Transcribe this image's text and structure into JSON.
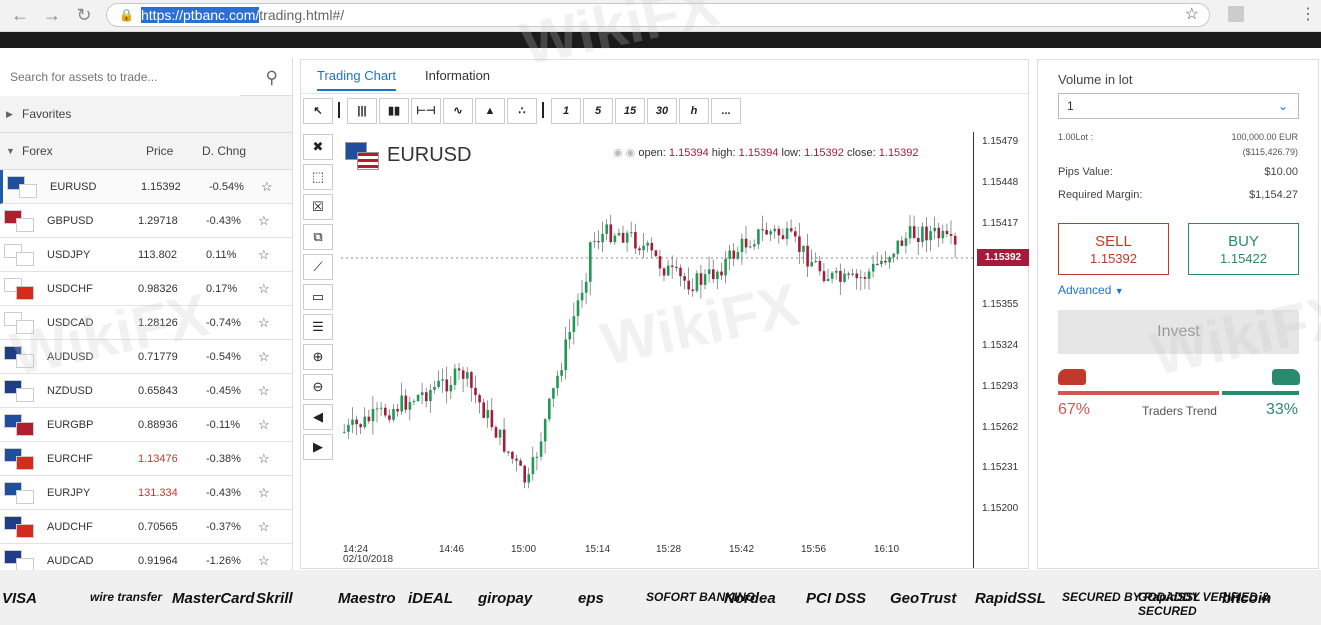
{
  "browser": {
    "url_selected": "https://ptbanc.com/",
    "url_rest": "trading.html#/"
  },
  "search": {
    "placeholder": "Search for assets to trade..."
  },
  "groups": {
    "favorites": "Favorites",
    "forex": "Forex",
    "col_price": "Price",
    "col_change": "D. Chng"
  },
  "assets": [
    {
      "symbol": "EURUSD",
      "price": "1.15392",
      "change": "-0.54%",
      "c1": "#1f4e9c",
      "c2": "#ffffff",
      "active": true
    },
    {
      "symbol": "GBPUSD",
      "price": "1.29718",
      "change": "-0.43%",
      "c1": "#b01e2f",
      "c2": "#ffffff"
    },
    {
      "symbol": "USDJPY",
      "price": "113.802",
      "change": "0.11%",
      "c1": "#ffffff",
      "c2": "#ffffff"
    },
    {
      "symbol": "USDCHF",
      "price": "0.98326",
      "change": "0.17%",
      "c1": "#ffffff",
      "c2": "#d52b1e"
    },
    {
      "symbol": "USDCAD",
      "price": "1.28126",
      "change": "-0.74%",
      "c1": "#ffffff",
      "c2": "#ffffff"
    },
    {
      "symbol": "AUDUSD",
      "price": "0.71779",
      "change": "-0.54%",
      "c1": "#1f3c88",
      "c2": "#ffffff"
    },
    {
      "symbol": "NZDUSD",
      "price": "0.65843",
      "change": "-0.45%",
      "c1": "#1f3c88",
      "c2": "#ffffff"
    },
    {
      "symbol": "EURGBP",
      "price": "0.88936",
      "change": "-0.11%",
      "c1": "#1f4e9c",
      "c2": "#b01e2f"
    },
    {
      "symbol": "EURCHF",
      "price": "1.13476",
      "change": "-0.38%",
      "c1": "#1f4e9c",
      "c2": "#d52b1e",
      "red": true
    },
    {
      "symbol": "EURJPY",
      "price": "131.334",
      "change": "-0.43%",
      "c1": "#1f4e9c",
      "c2": "#ffffff",
      "red": true
    },
    {
      "symbol": "AUDCHF",
      "price": "0.70565",
      "change": "-0.37%",
      "c1": "#1f3c88",
      "c2": "#d52b1e"
    },
    {
      "symbol": "AUDCAD",
      "price": "0.91964",
      "change": "-1.26%",
      "c1": "#1f3c88",
      "c2": "#ffffff"
    }
  ],
  "tabs": {
    "chart": "Trading Chart",
    "info": "Information"
  },
  "toolbar": {
    "periods": [
      "1",
      "5",
      "15",
      "30",
      "h",
      "..."
    ],
    "chart_types": [
      "bars-icon",
      "candles-icon",
      "ohlc-icon",
      "line-icon",
      "area-icon",
      "dots-icon"
    ]
  },
  "chart": {
    "symbol": "EURUSD",
    "open_label": "open:",
    "open": "1.15394",
    "high_label": "high:",
    "high": "1.15394",
    "low_label": "low:",
    "low": "1.15392",
    "close_label": "close:",
    "close": "1.15392",
    "current_price": "1.15392",
    "price_ticks": [
      "1.15479",
      "1.15448",
      "1.15417",
      "1.15386",
      "1.15355",
      "1.15324",
      "1.15293",
      "1.15262",
      "1.15231",
      "1.15200"
    ],
    "time_ticks": [
      "14:24",
      "14:46",
      "15:00",
      "15:14",
      "15:28",
      "15:42",
      "15:56",
      "16:10"
    ],
    "date_label": "02/10/2018"
  },
  "trade": {
    "volume_label": "Volume in lot",
    "volume_value": "1",
    "lot_label": "1.00Lot :",
    "lot_value": "100,000.00 EUR",
    "lot_value_usd": "($115,426.79)",
    "pips_label": "Pips Value:",
    "pips_value": "$10.00",
    "margin_label": "Required Margin:",
    "margin_value": "$1,154.27",
    "sell_label": "SELL",
    "sell_price": "1.15392",
    "buy_label": "BUY",
    "buy_price": "1.15422",
    "advanced": "Advanced",
    "invest": "Invest",
    "sell_pct": "67%",
    "buy_pct": "33%",
    "sell_fraction": 0.67,
    "trend_label": "Traders Trend"
  },
  "payments": [
    "VISA",
    "wire transfer",
    "MasterCard",
    "Skrill",
    "Maestro",
    "iDEAL",
    "giropay",
    "eps",
    "SOFORT BANKING",
    "Nordea",
    "PCI DSS",
    "GeoTrust",
    "RapidSSL",
    "SECURED BY RapidSSL",
    "GODADDY VERIFIED & SECURED",
    "bitcoin"
  ],
  "watermark": "WikiFX"
}
